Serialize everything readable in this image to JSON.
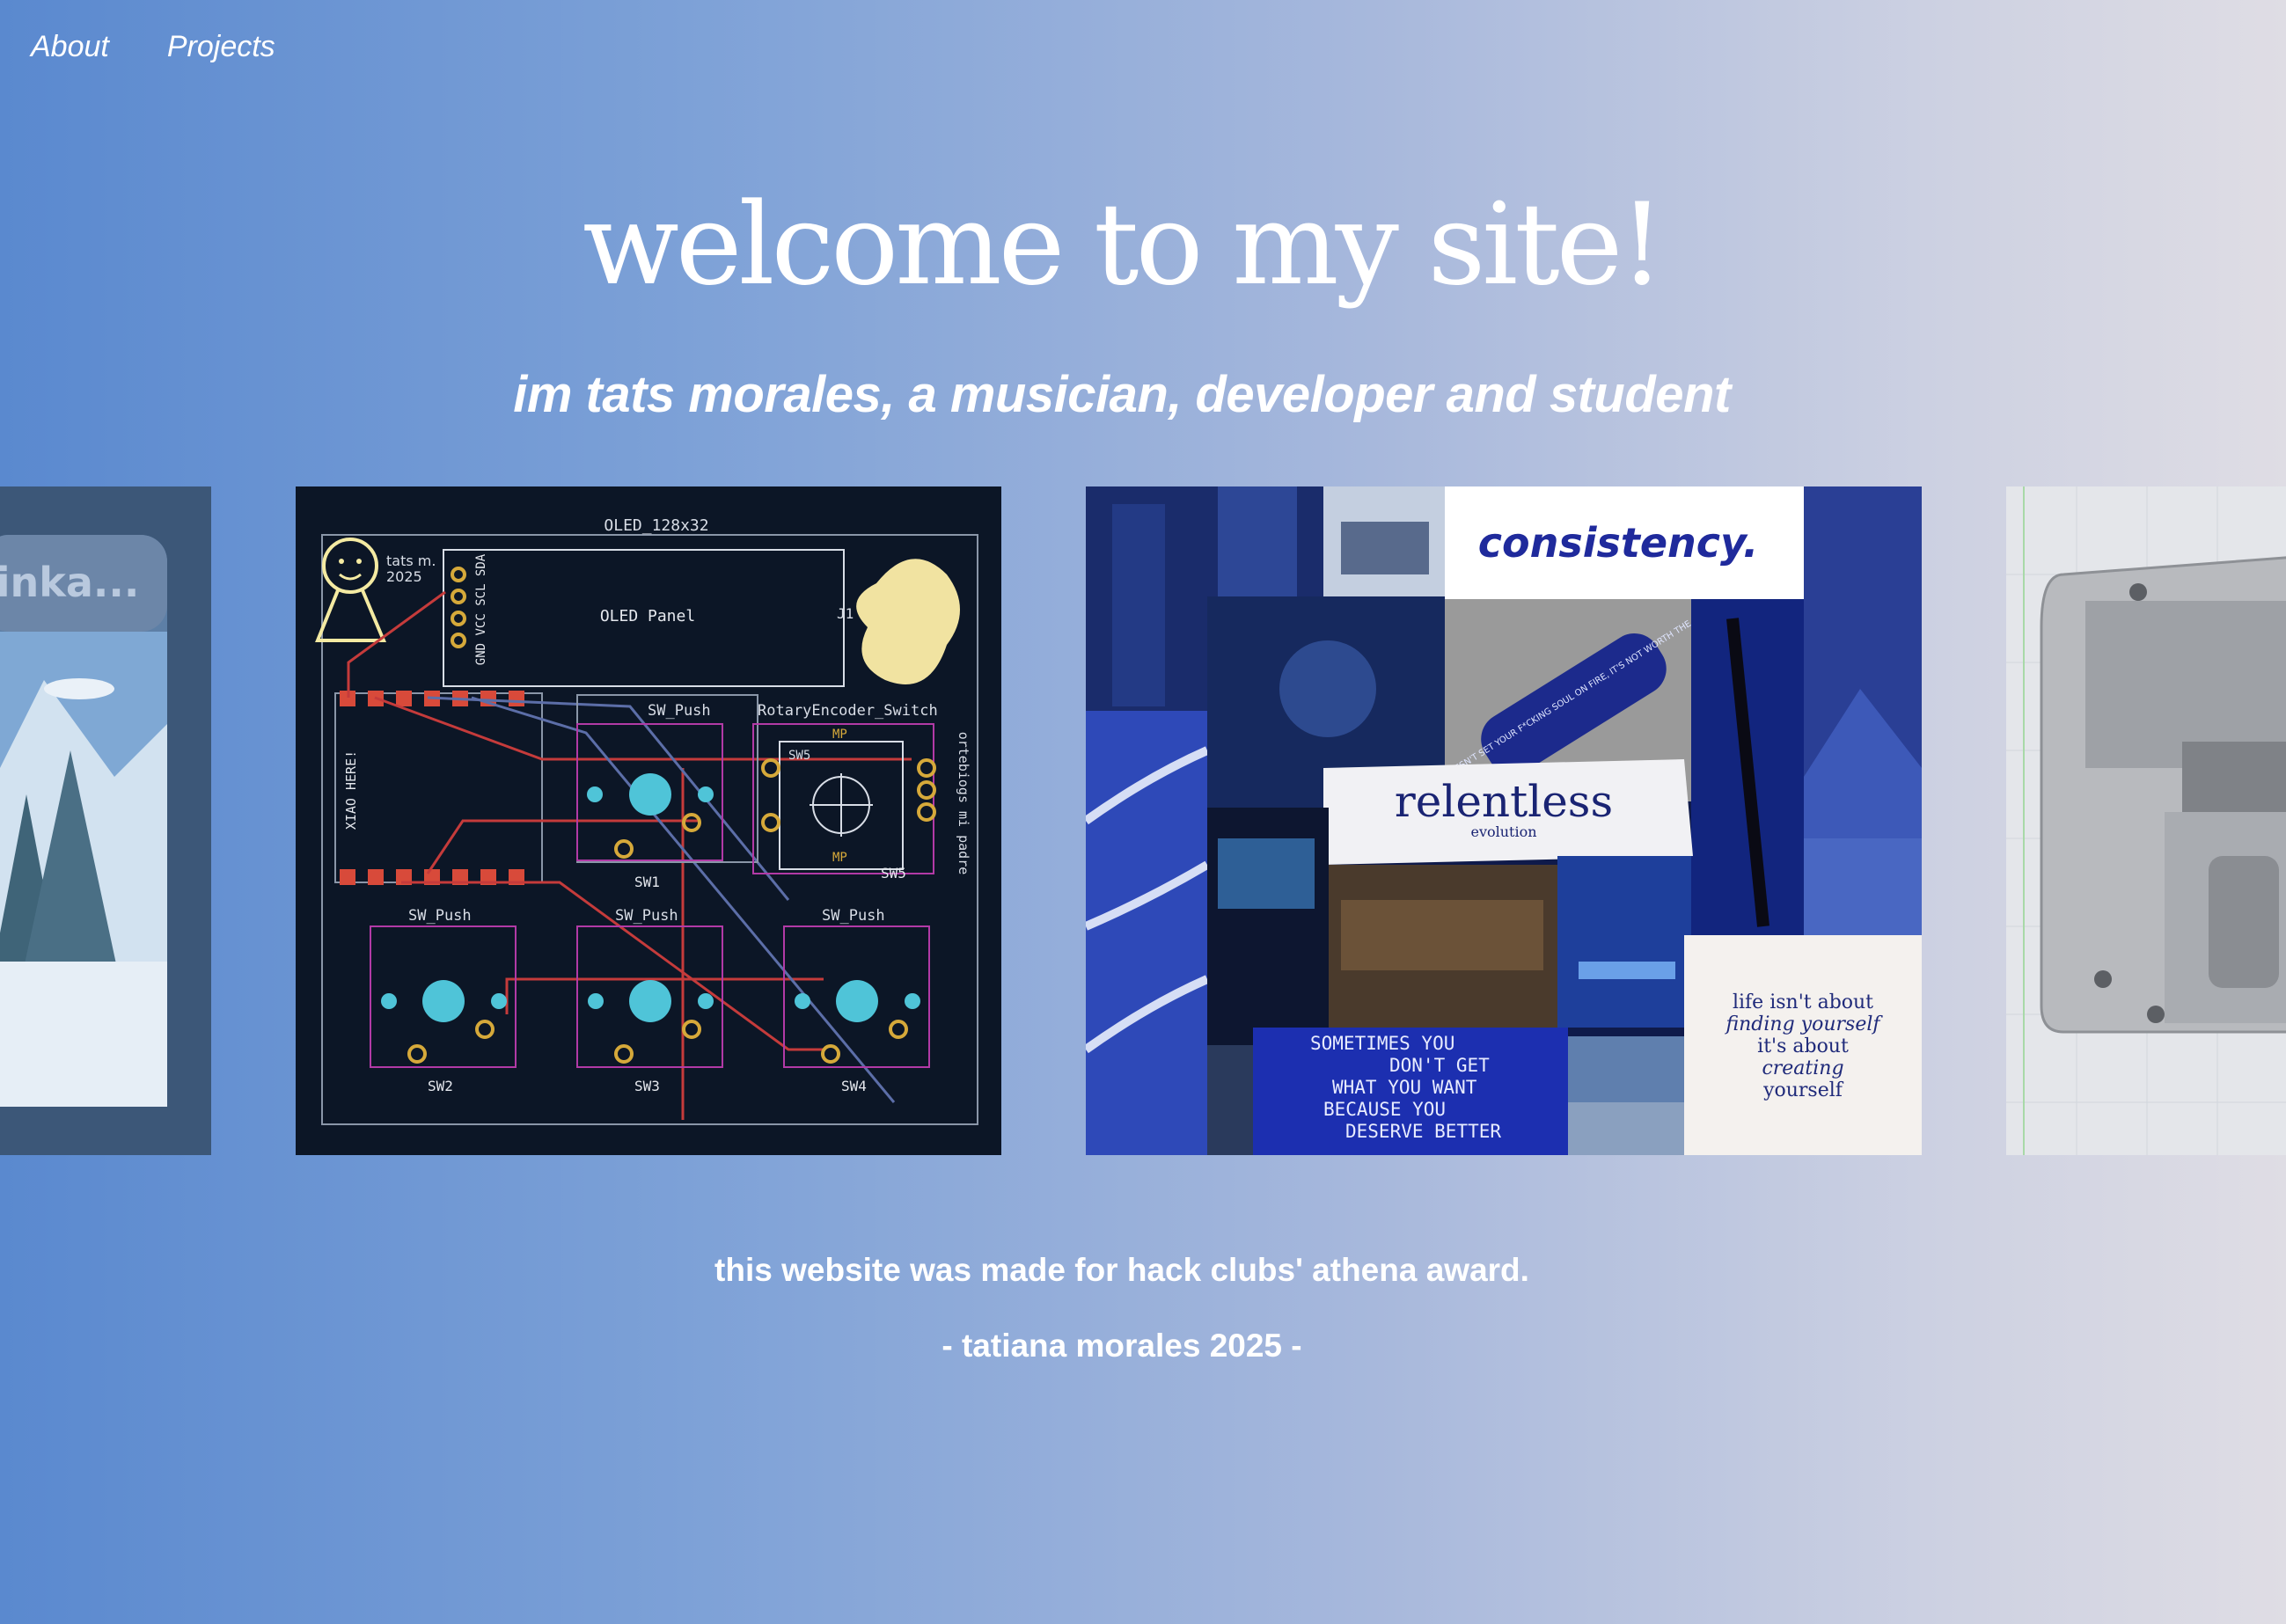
{
  "nav": {
    "items": [
      {
        "label": "About"
      },
      {
        "label": "Projects"
      }
    ]
  },
  "hero": {
    "title": "welcome to my site!",
    "subtitle": "im tats morales, a musician, developer and student"
  },
  "carousel": {
    "slides": [
      {
        "name": "pixel-art-winter",
        "caption": "linka..."
      },
      {
        "name": "pcb-macropad",
        "labels": {
          "oled": "OLED_128x32",
          "oled_panel": "OLED Panel",
          "j1": "J1",
          "tats": "tats m.",
          "year": "2025",
          "pins": "GND VCC SCL SDA",
          "xiao": "XIAO HERE!",
          "sw_push": "SW_Push",
          "rotary": "RotaryEncoder_Switch",
          "mp": "MP",
          "sw5_top": "SW5",
          "sw1": "SW1",
          "sw5": "SW5",
          "side": "ortebiogs mi padre",
          "sw2": "SW2",
          "sw3": "SW3",
          "sw4": "SW4"
        }
      },
      {
        "name": "moodboard-collage",
        "labels": {
          "consistency": "consistency.",
          "relentless": "relentless",
          "evolution": "evolution",
          "lighter": "IF IT DOESN'T SET YOUR F*CKING SOUL ON FIRE, IT'S NOT WORTH THE BURN",
          "quote_lines": [
            "SOMETIMES YOU",
            "DON'T GET",
            "WHAT YOU WANT",
            "BECAUSE YOU",
            "DESERVE BETTER"
          ],
          "life_lines": [
            "life isn't about",
            "finding yourself",
            "it's about",
            "creating",
            "yourself"
          ]
        }
      },
      {
        "name": "3d-case-render"
      }
    ]
  },
  "footer": {
    "note": "this website was made for hack clubs' athena award.",
    "signature": "- tatiana morales 2025 -"
  },
  "colors": {
    "gradient_start": "#5a89cf",
    "gradient_end": "#dfdde4",
    "pcb_bg": "#0c1626",
    "pad_cyan": "#4fc4d8",
    "trace_red": "#c53b3b",
    "pad_gold": "#d6a93a",
    "collage_blue": "#1f2f9c"
  }
}
